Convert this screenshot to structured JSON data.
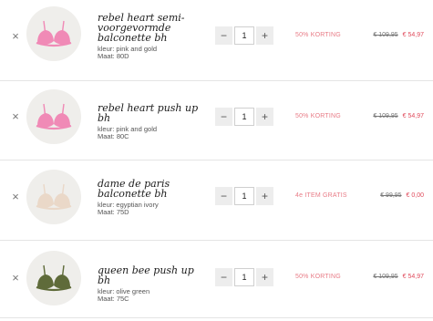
{
  "colors": {
    "accent": "#e87b86",
    "price_new": "#e04b5c",
    "divider": "#e4e4e4"
  },
  "items": [
    {
      "name": "rebel heart semi-voorgevormde balconette bh",
      "color_label": "kleur: pink and gold",
      "size_label": "Maat: 80D",
      "quantity": "1",
      "promo": "50% KORTING",
      "old_price": "€ 109,95",
      "new_price": "€ 54,97",
      "bra_color": "#f08ab6",
      "remove_icon": "close-icon"
    },
    {
      "name": "rebel heart push up bh",
      "color_label": "kleur: pink and gold",
      "size_label": "Maat: 80C",
      "quantity": "1",
      "promo": "50% KORTING",
      "old_price": "€ 109,95",
      "new_price": "€ 54,97",
      "bra_color": "#f08ab6",
      "remove_icon": "close-icon"
    },
    {
      "name": "dame de paris balconette bh",
      "color_label": "kleur: egyptian ivory",
      "size_label": "Maat: 75D",
      "quantity": "1",
      "promo": "4e ITEM GRATIS",
      "old_price": "€ 99,95",
      "new_price": "€ 0,00",
      "bra_color": "#ead8c8",
      "remove_icon": "close-icon"
    },
    {
      "name": "queen bee push up bh",
      "color_label": "kleur: olive green",
      "size_label": "Maat: 75C",
      "quantity": "1",
      "promo": "50% KORTING",
      "old_price": "€ 109,95",
      "new_price": "€ 54,97",
      "bra_color": "#5f6b3a",
      "remove_icon": "close-icon"
    }
  ],
  "qty_minus": "−",
  "qty_plus": "+",
  "remove_symbol": "×"
}
